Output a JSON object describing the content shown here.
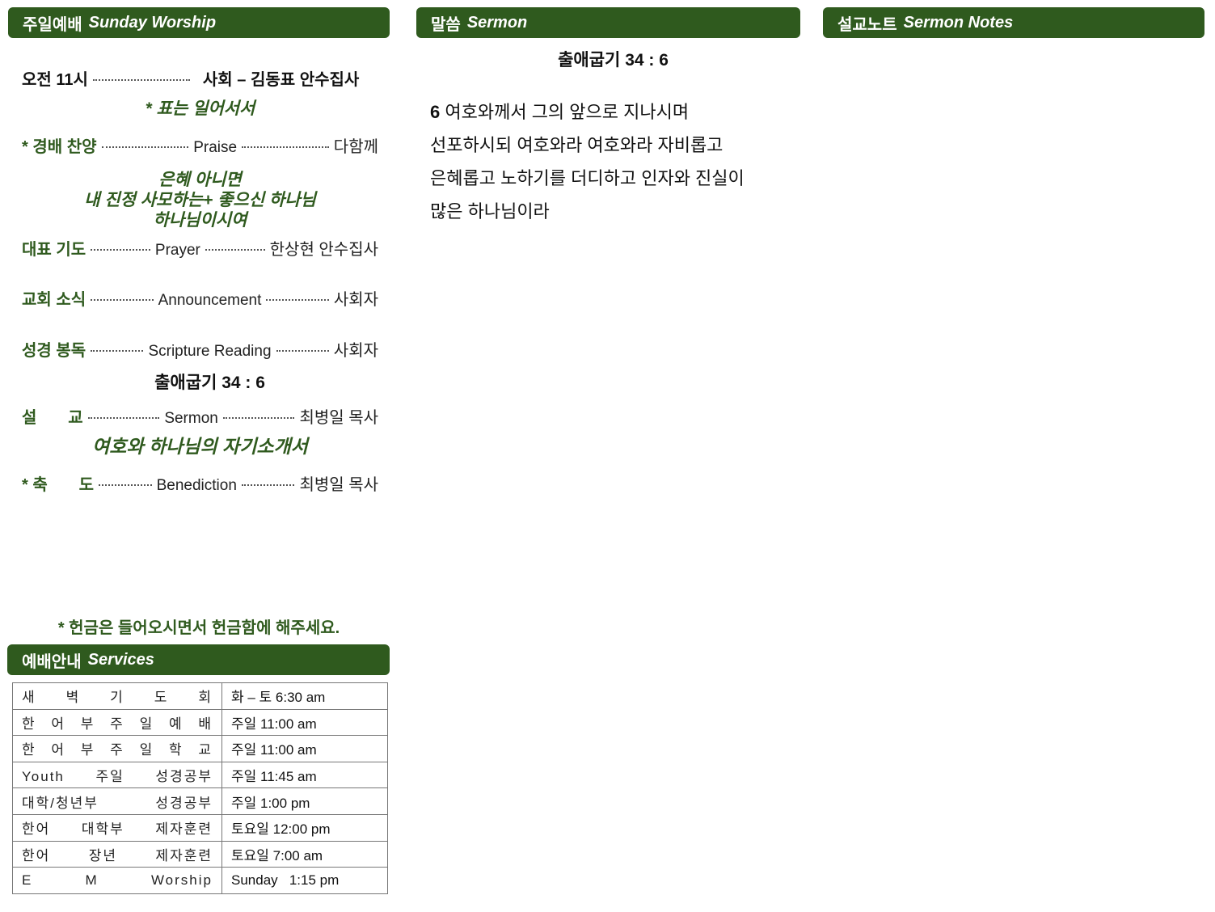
{
  "worship": {
    "header_ko": "주일예배",
    "header_en": "Sunday Worship",
    "time_label": "오전 11시",
    "host": "사회 – 김동표 안수집사",
    "stand_note": "* 표는 일어서서",
    "items": [
      {
        "label": "* 경배 찬양",
        "middle": "Praise",
        "right": "다함께"
      },
      {
        "label": "대표 기도",
        "middle": "Prayer",
        "right": "한상현 안수집사"
      },
      {
        "label": "교회 소식",
        "middle": "Announcement",
        "right": "사회자"
      },
      {
        "label": "성경 봉독",
        "middle": "Scripture Reading",
        "right": "사회자"
      },
      {
        "label": "설       교",
        "middle": "Sermon",
        "right": "최병일 목사"
      },
      {
        "label": "* 축       도",
        "middle": "Benediction",
        "right": "최병일 목사"
      }
    ],
    "praise_songs": [
      "은혜 아니면",
      "내 진정 사모하는+ 좋으신 하나님",
      "하나님이시여"
    ],
    "scripture_ref": "출애굽기 34 : 6",
    "sermon_title": "여호와 하나님의 자기소개서",
    "offering_notice": "* 헌금은 들어오시면서 헌금함에 해주세요."
  },
  "sermon": {
    "header_ko": "말씀",
    "header_en": "Sermon",
    "reference": "출애굽기 34 : 6",
    "verse_number": "6",
    "verse_lines": [
      "여호와께서 그의 앞으로 지나시며",
      "선포하시되 여호와라 여호와라 자비롭고",
      "은혜롭고 노하기를 더디하고 인자와 진실이",
      "많은 하나님이라"
    ]
  },
  "notes": {
    "header_ko": "설교노트",
    "header_en": "Sermon Notes"
  },
  "services": {
    "header_ko": "예배안내",
    "header_en": "Services",
    "rows": [
      {
        "name": "새 벽 기 도 회",
        "time": "화 – 토 6:30 am"
      },
      {
        "name": "한 어 부  주 일 예 배",
        "time": "주일 11:00 am"
      },
      {
        "name": "한 어 부  주 일 학 교",
        "time": "주일 11:00 am"
      },
      {
        "name": "Youth 주일 성경공부",
        "time": "주일 11:45 am"
      },
      {
        "name": "대학/청년부 성경공부",
        "time": "주일 1:00 pm"
      },
      {
        "name": "한어 대학부 제자훈련",
        "time": "토요일 12:00 pm"
      },
      {
        "name": "한어 장년 제자훈련",
        "time": "토요일 7:00 am"
      },
      {
        "name": "E M Worship",
        "time": "Sunday   1:15 pm"
      }
    ]
  },
  "colors": {
    "accent": "#2f5a1e"
  }
}
